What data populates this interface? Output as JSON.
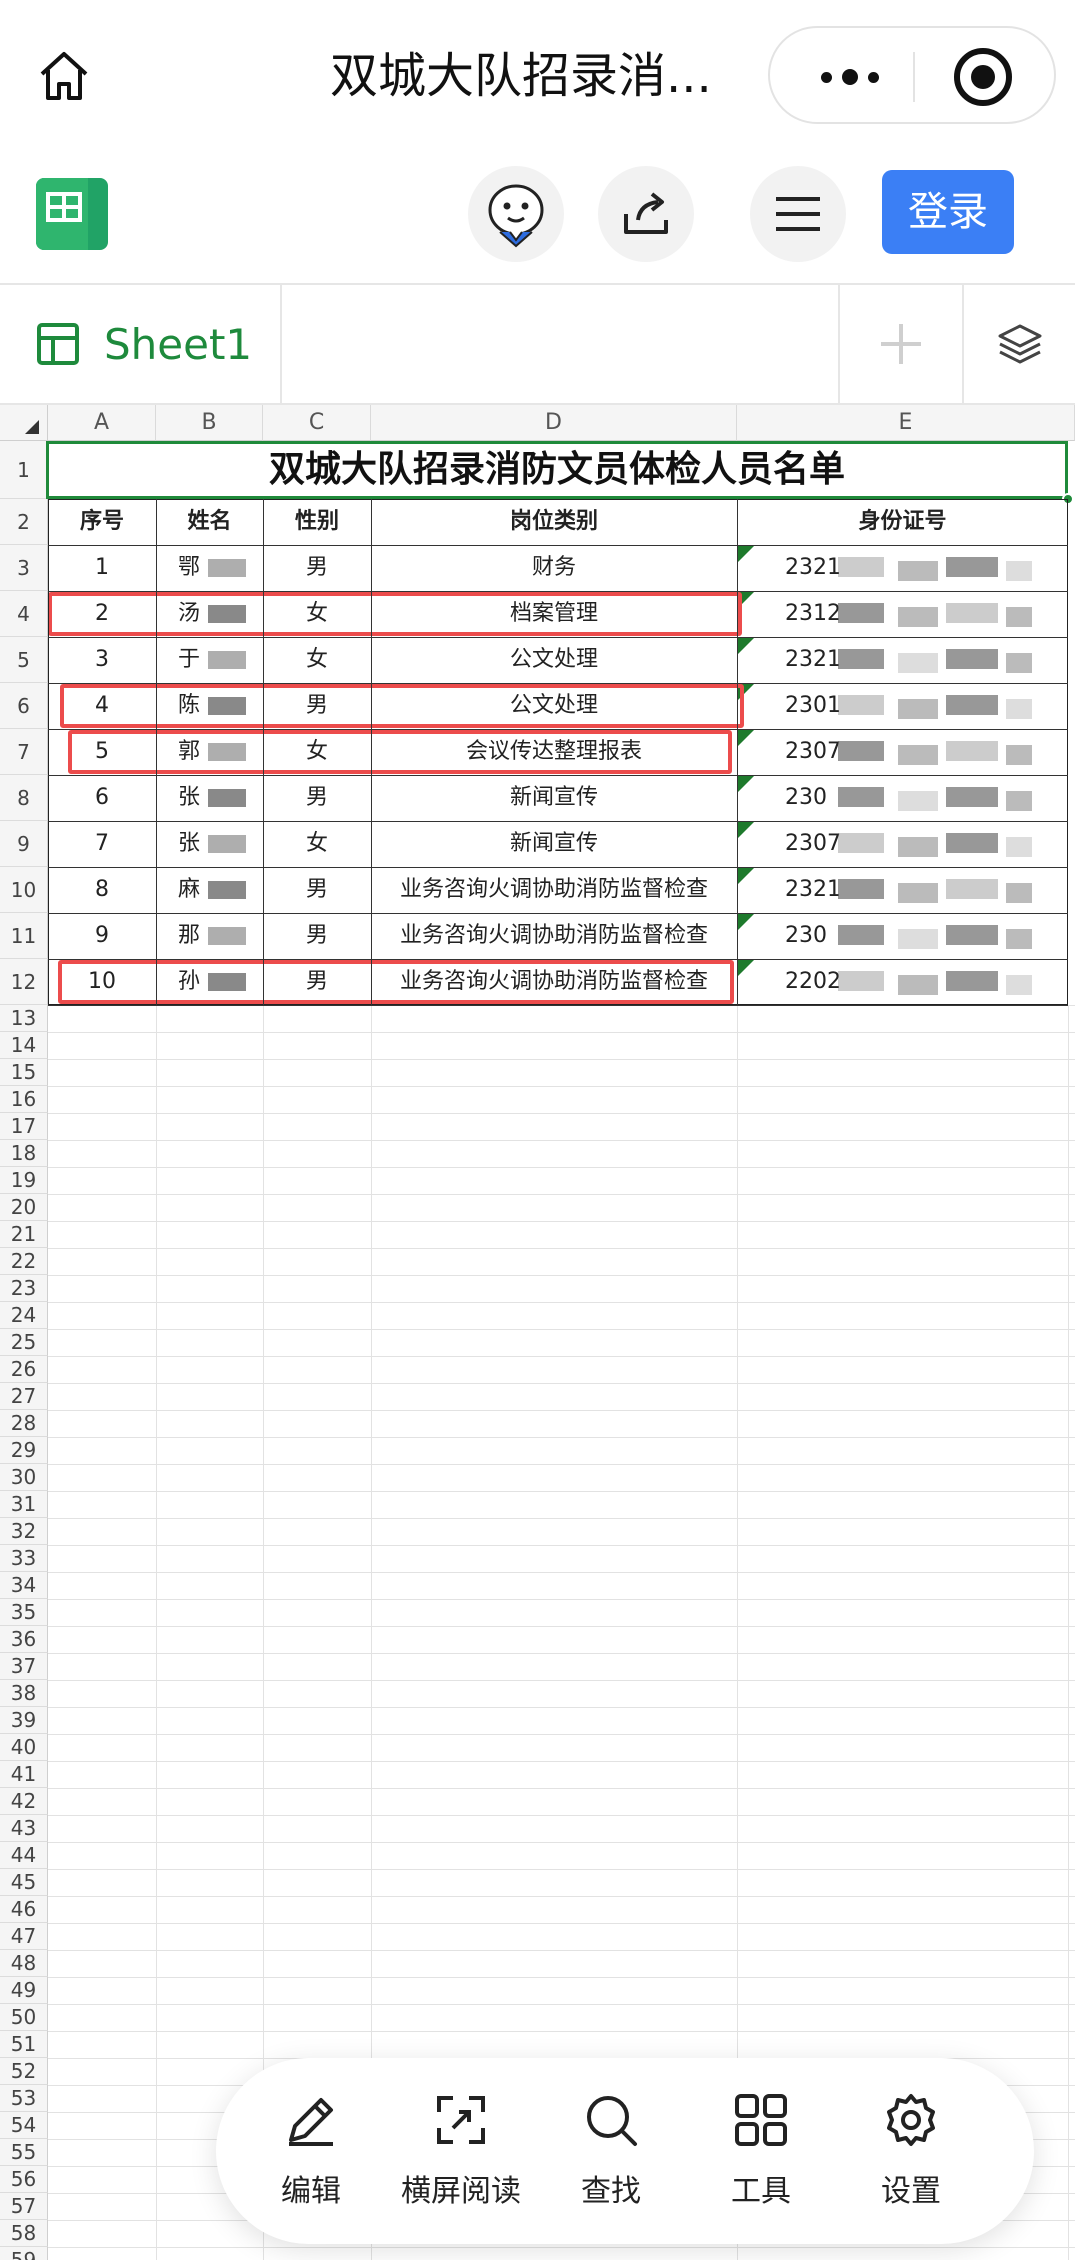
{
  "titlebar": {
    "title": "双城大队招录消..."
  },
  "app": {
    "login_label": "登录"
  },
  "sheet_tab": {
    "label": "Sheet1"
  },
  "columns": [
    "A",
    "B",
    "C",
    "D",
    "E"
  ],
  "spreadsheet": {
    "title": "双城大队招录消防文员体检人员名单",
    "headers": [
      "序号",
      "姓名",
      "性别",
      "岗位类别",
      "身份证号"
    ],
    "rows": [
      {
        "no": "1",
        "name": "鄂",
        "gender": "男",
        "job": "财务",
        "id": "2321"
      },
      {
        "no": "2",
        "name": "汤",
        "gender": "女",
        "job": "档案管理",
        "id": "2312"
      },
      {
        "no": "3",
        "name": "于",
        "gender": "女",
        "job": "公文处理",
        "id": "2321"
      },
      {
        "no": "4",
        "name": "陈",
        "gender": "男",
        "job": "公文处理",
        "id": "2301"
      },
      {
        "no": "5",
        "name": "郭",
        "gender": "女",
        "job": "会议传达整理报表",
        "id": "2307"
      },
      {
        "no": "6",
        "name": "张",
        "gender": "男",
        "job": "新闻宣传",
        "id": "230"
      },
      {
        "no": "7",
        "name": "张",
        "gender": "女",
        "job": "新闻宣传",
        "id": "2307"
      },
      {
        "no": "8",
        "name": "麻",
        "gender": "男",
        "job": "业务咨询火调协助消防监督检查",
        "id": "2321"
      },
      {
        "no": "9",
        "name": "那",
        "gender": "男",
        "job": "业务咨询火调协助消防监督检查",
        "id": "230"
      },
      {
        "no": "10",
        "name": "孙",
        "gender": "男",
        "job": "业务咨询火调协助消防监督检查",
        "id": "2202"
      }
    ],
    "highlighted_rows": [
      2,
      4,
      5,
      10
    ],
    "visible_row_count": 59
  },
  "bottom_bar": {
    "items": [
      {
        "label": "编辑",
        "icon": "pencil-icon"
      },
      {
        "label": "横屏阅读",
        "icon": "expand-icon"
      },
      {
        "label": "查找",
        "icon": "search-icon"
      },
      {
        "label": "工具",
        "icon": "grid-tools-icon"
      },
      {
        "label": "设置",
        "icon": "gear-icon"
      }
    ]
  },
  "colors": {
    "accent_green": "#1f8a3a",
    "login_blue": "#3b7ff5",
    "highlight_red": "#ec4c4c"
  }
}
